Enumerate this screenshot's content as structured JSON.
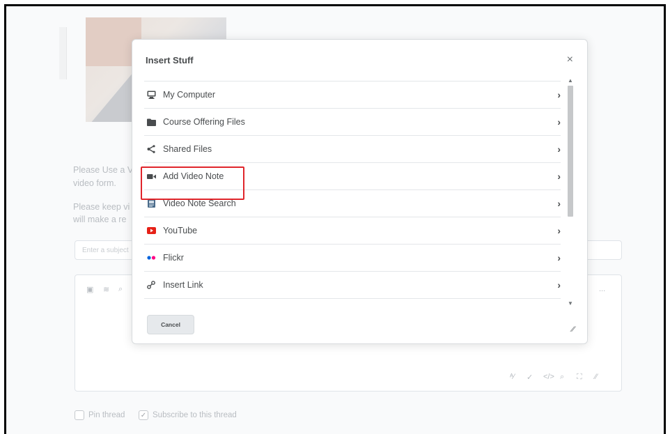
{
  "background": {
    "instruction_lines": [
      "Please Use a V",
      "video form.",
      "Please keep vi",
      "will make a re"
    ],
    "subject_placeholder": "Enter a subject",
    "editor_more_label": "...",
    "pin_label": "Pin thread",
    "subscribe_label": "Subscribe to this thread"
  },
  "dialog": {
    "title": "Insert Stuff",
    "close_glyph": "×",
    "items": [
      {
        "label": "My Computer",
        "icon": "computer-icon"
      },
      {
        "label": "Course Offering Files",
        "icon": "folder-icon"
      },
      {
        "label": "Shared Files",
        "icon": "share-icon"
      },
      {
        "label": "Add Video Note",
        "icon": "video-camera-icon",
        "highlighted": true
      },
      {
        "label": "Video Note Search",
        "icon": "video-note-search-icon"
      },
      {
        "label": "YouTube",
        "icon": "youtube-icon"
      },
      {
        "label": "Flickr",
        "icon": "flickr-icon"
      },
      {
        "label": "Insert Link",
        "icon": "link-icon"
      }
    ],
    "chevron_glyph": "›",
    "cancel_label": "Cancel"
  },
  "colors": {
    "highlight_box": "#e0252b",
    "youtube_red": "#e62117",
    "flickr_blue": "#0063dc",
    "flickr_pink": "#ff0084",
    "text": "#494c4e"
  }
}
